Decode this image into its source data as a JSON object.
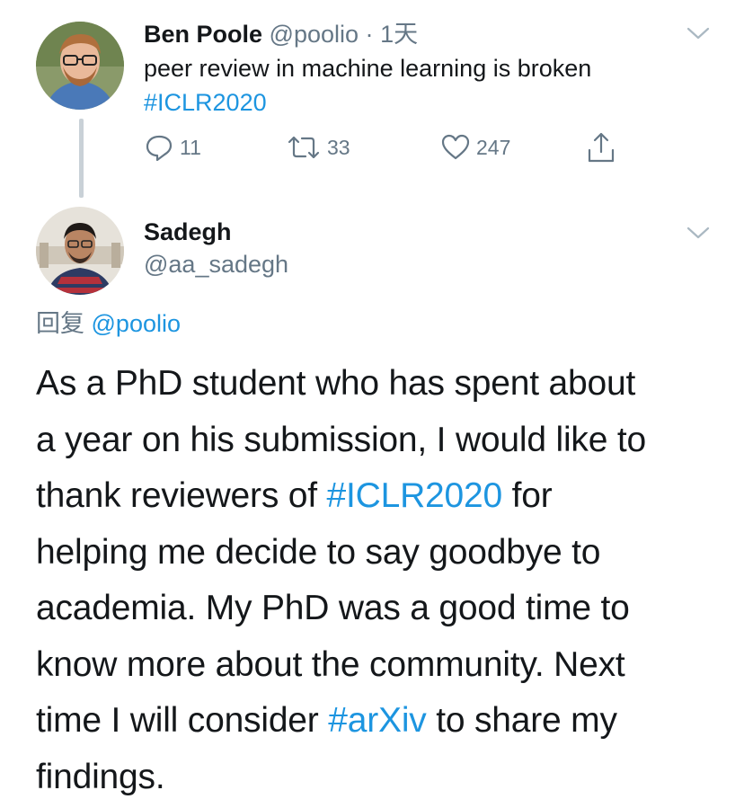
{
  "tweet1": {
    "author_name": "Ben Poole",
    "author_handle": "@poolio",
    "separator": "·",
    "time": "1天",
    "text": "peer review in machine learning is broken",
    "hashtag": "#ICLR2020",
    "reply_count": "11",
    "retweet_count": "33",
    "like_count": "247"
  },
  "tweet2": {
    "author_name": "Sadegh",
    "author_handle": "@aa_sadegh",
    "reply_prefix": "回复",
    "reply_mention": "@poolio",
    "lines": {
      "l1": "As a PhD student who has spent about",
      "l2": "a year on his submission, I would like to",
      "l3_pre": "thank reviewers of ",
      "l3_tag": "#ICLR2020",
      "l3_post": " for",
      "l4": "helping me decide to say goodbye to",
      "l5": "academia. My PhD was a good time to",
      "l6": "know more about the community. Next",
      "l7_pre": "time I will consider ",
      "l7_tag": "#arXiv",
      "l7_post": " to share my",
      "l8": "findings."
    }
  },
  "colors": {
    "text": "#14171a",
    "secondary": "#657786",
    "link": "#1d95e0",
    "thread_line": "#c9d1d7"
  },
  "icons": {
    "reply": "reply-icon",
    "retweet": "retweet-icon",
    "like": "heart-icon",
    "share": "share-icon",
    "menu": "chevron-down-icon"
  }
}
